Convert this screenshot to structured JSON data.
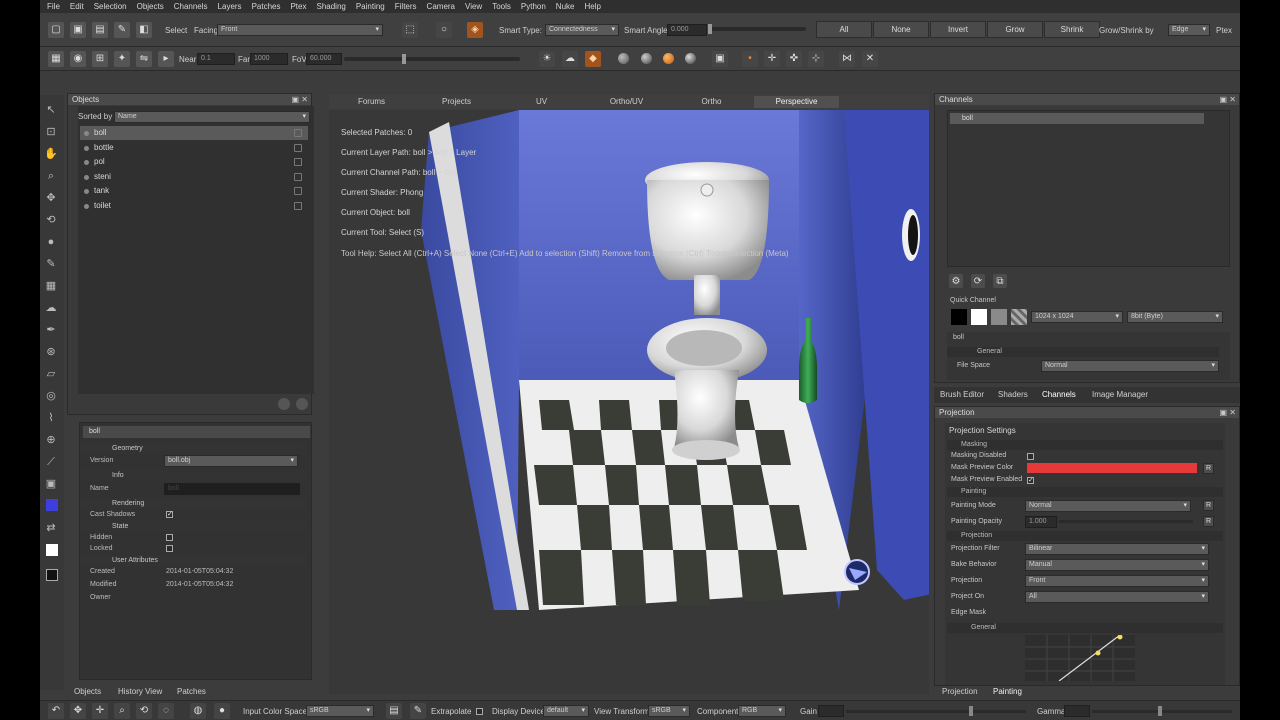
{
  "menu": [
    "File",
    "Edit",
    "Selection",
    "Objects",
    "Channels",
    "Layers",
    "Patches",
    "Ptex",
    "Shading",
    "Painting",
    "Filters",
    "Camera",
    "View",
    "Tools",
    "Python",
    "Nuke",
    "Help"
  ],
  "toolbar1": {
    "select_label": "Select",
    "facing_label": "Facing",
    "facing_value": "Front",
    "smart_type_label": "Smart Type:",
    "smart_type_value": "Connectedness",
    "smart_angle_label": "Smart Angle",
    "smart_angle_value": "0.000",
    "buttons": [
      "All",
      "None",
      "Invert",
      "Grow",
      "Shrink"
    ],
    "grow_shrink_label": "Grow/Shrink by",
    "grow_shrink_value": "Edge",
    "ptex_label": "Ptex"
  },
  "toolbar2": {
    "near_label": "Near",
    "near_value": "0.1",
    "far_label": "Far",
    "far_value": "1000",
    "fov_label": "FoV",
    "fov_value": "60.000"
  },
  "objects_panel": {
    "title": "Objects",
    "sorted_by_label": "Sorted by",
    "sorted_by_value": "Name",
    "items": [
      "boll",
      "bottle",
      "pol",
      "steni",
      "tank",
      "toilet"
    ],
    "selected_index": 0
  },
  "attributes_panel": {
    "object_name": "boll",
    "sections": {
      "geometry": "Geometry",
      "info": "Info",
      "rendering": "Rendering",
      "state": "State",
      "user_attributes": "User Attributes"
    },
    "version_label": "Version",
    "version_value": "boll.obj",
    "name_label": "Name",
    "name_value": "boll",
    "cast_shadows_label": "Cast Shadows",
    "hidden_label": "Hidden",
    "locked_label": "Locked",
    "created_label": "Created",
    "created_value": "2014-01-05T05:04:32",
    "modified_label": "Modified",
    "modified_value": "2014-01-05T05:04:32",
    "owner_label": "Owner",
    "bottom_tabs": [
      "Objects",
      "History View",
      "Patches"
    ]
  },
  "viewport": {
    "tabs": [
      "Forums",
      "Projects",
      "UV",
      "Ortho/UV",
      "Ortho",
      "Perspective"
    ],
    "active_tab": 5,
    "info": [
      "Selected Patches: 0",
      "Current Layer Path: boll > boll > Layer",
      "Current Channel Path: boll > boll",
      "Current Shader: Phong",
      "Current Object: boll",
      "Current Tool: Select (S)"
    ],
    "tool_help": "Tool Help: Select All (Ctrl+A)   Select None (Ctrl+E)   Add to selection (Shift)   Remove from selection (Ctrl)   Toggle selection (Meta)"
  },
  "channels_panel": {
    "title": "Channels",
    "channel_item": "boll",
    "quick_channel_label": "Quick Channel",
    "resolution_value": "1024 x 1024",
    "depth_value": "8bit (Byte)",
    "item_name": "boll",
    "general_label": "General",
    "file_space_label": "File Space",
    "file_space_value": "Normal",
    "tabs": [
      "Brush Editor",
      "Shaders",
      "Channels",
      "Image Manager"
    ],
    "active_tab": 2
  },
  "projection_panel": {
    "title": "Projection",
    "settings_label": "Projection Settings",
    "masking_label": "Masking",
    "masking_disabled_label": "Masking Disabled",
    "mask_preview_color_label": "Mask Preview Color",
    "mask_preview_color": "#e8393a",
    "mask_preview_enabled_label": "Mask Preview Enabled",
    "painting_label": "Painting",
    "painting_mode_label": "Painting Mode",
    "painting_mode_value": "Normal",
    "painting_opacity_label": "Painting Opacity",
    "painting_opacity_value": "1.000",
    "projection_section_label": "Projection",
    "projection_filter_label": "Projection Filter",
    "projection_filter_value": "Bilinear",
    "bake_behavior_label": "Bake Behavior",
    "bake_behavior_value": "Manual",
    "projection_label": "Projection",
    "projection_value": "Front",
    "project_on_label": "Project On",
    "project_on_value": "All",
    "edge_mask_label": "Edge Mask",
    "general_label": "General",
    "r_label": "R",
    "bottom_tabs": [
      "Projection",
      "Painting"
    ]
  },
  "bottombar": {
    "input_color_space_label": "Input Color Space",
    "input_color_space_value": "sRGB",
    "extrapolate_label": "Extrapolate",
    "display_device_label": "Display Device",
    "display_device_value": "default",
    "view_transform_label": "View Transform",
    "view_transform_value": "sRGB",
    "component_label": "Component",
    "component_value": "RGB",
    "gain_label": "Gain",
    "gamma_label": "Gamma"
  }
}
